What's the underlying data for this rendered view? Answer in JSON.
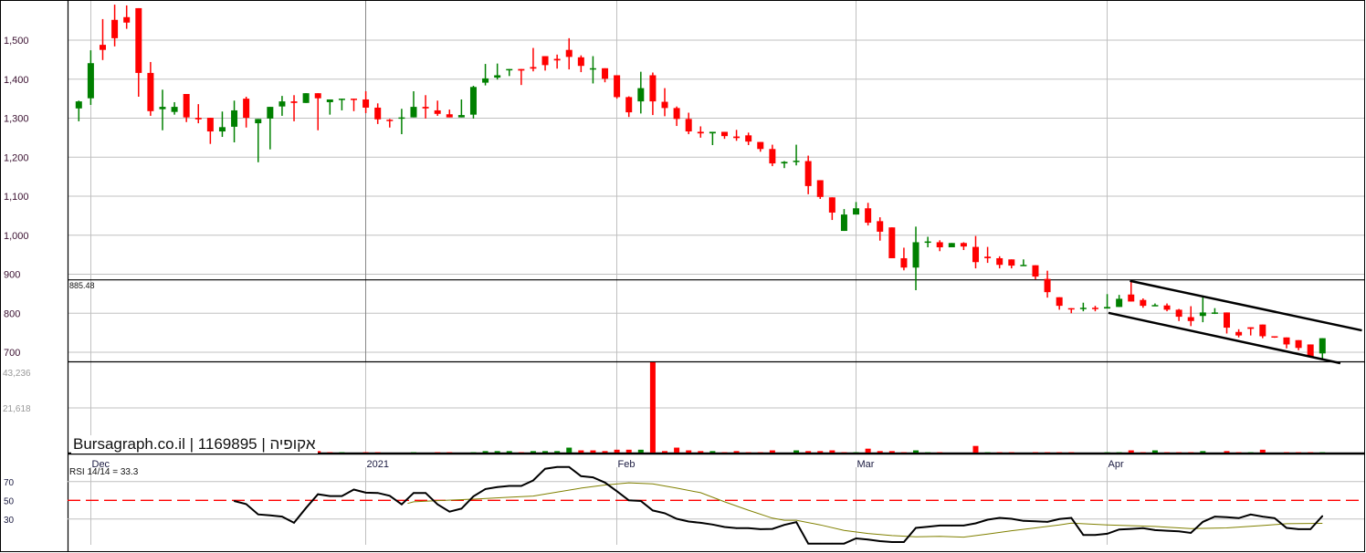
{
  "chart_data": {
    "type": "candlestick",
    "title": "Bursagraph.co.il | 1169895 | אקופיה",
    "colors": {
      "up": "#008000",
      "down": "#ff0000",
      "grid": "#c0c0c0",
      "axis_text": "#3a1030",
      "volume_text": "#999999",
      "rsi_line": "#000000",
      "rsi_signal": "#808000",
      "rsi_midline": "#ff0000"
    },
    "price_axis": {
      "ticks": [
        1500,
        1400,
        1300,
        1200,
        1100,
        1000,
        900,
        800,
        700
      ],
      "tick_labels": [
        "1,500",
        "1,400",
        "1,300",
        "1,200",
        "1,100",
        "1,000",
        "900",
        "800",
        "700"
      ],
      "ylim": [
        680,
        1600
      ]
    },
    "x_labels": [
      {
        "index": 1,
        "label": "Dec"
      },
      {
        "index": 24,
        "label": "2021"
      },
      {
        "index": 45,
        "label": "Feb"
      },
      {
        "index": 65,
        "label": "Mar"
      },
      {
        "index": 86,
        "label": "Apr"
      }
    ],
    "ohlc": [
      [
        1325,
        1345,
        1292,
        1343
      ],
      [
        1351,
        1474,
        1334,
        1441
      ],
      [
        1488,
        1554,
        1449,
        1475
      ],
      [
        1552,
        1591,
        1484,
        1505
      ],
      [
        1559,
        1589,
        1529,
        1545
      ],
      [
        1582,
        1582,
        1355,
        1416
      ],
      [
        1416,
        1444,
        1306,
        1318
      ],
      [
        1323,
        1373,
        1269,
        1329
      ],
      [
        1316,
        1341,
        1309,
        1329
      ],
      [
        1362,
        1362,
        1290,
        1302
      ],
      [
        1301,
        1336,
        1287,
        1297
      ],
      [
        1301,
        1301,
        1234,
        1266
      ],
      [
        1266,
        1317,
        1252,
        1277
      ],
      [
        1278,
        1345,
        1238,
        1320
      ],
      [
        1350,
        1355,
        1276,
        1301
      ],
      [
        1287,
        1298,
        1187,
        1298
      ],
      [
        1299,
        1329,
        1220,
        1329
      ],
      [
        1330,
        1357,
        1306,
        1343
      ],
      [
        1343,
        1359,
        1292,
        1339
      ],
      [
        1339,
        1364,
        1339,
        1364
      ],
      [
        1364,
        1364,
        1269,
        1351
      ],
      [
        1341,
        1348,
        1309,
        1348
      ],
      [
        1348,
        1350,
        1320,
        1350
      ],
      [
        1350,
        1350,
        1318,
        1348
      ],
      [
        1348,
        1369,
        1313,
        1327
      ],
      [
        1327,
        1338,
        1285,
        1297
      ],
      [
        1296,
        1298,
        1276,
        1294
      ],
      [
        1299,
        1324,
        1259,
        1302
      ],
      [
        1302,
        1369,
        1302,
        1329
      ],
      [
        1329,
        1359,
        1299,
        1325
      ],
      [
        1320,
        1345,
        1306,
        1311
      ],
      [
        1310,
        1322,
        1302,
        1302
      ],
      [
        1302,
        1348,
        1302,
        1308
      ],
      [
        1309,
        1383,
        1299,
        1380
      ],
      [
        1391,
        1439,
        1384,
        1402
      ],
      [
        1404,
        1440,
        1399,
        1410
      ],
      [
        1425,
        1426,
        1408,
        1426
      ],
      [
        1426,
        1426,
        1385,
        1422
      ],
      [
        1431,
        1480,
        1420,
        1427
      ],
      [
        1459,
        1459,
        1422,
        1436
      ],
      [
        1452,
        1463,
        1427,
        1448
      ],
      [
        1475,
        1505,
        1425,
        1457
      ],
      [
        1456,
        1461,
        1418,
        1434
      ],
      [
        1427,
        1459,
        1389,
        1428
      ],
      [
        1428,
        1428,
        1392,
        1401
      ],
      [
        1410,
        1410,
        1350,
        1354
      ],
      [
        1354,
        1356,
        1303,
        1315
      ],
      [
        1343,
        1419,
        1312,
        1377
      ],
      [
        1410,
        1417,
        1308,
        1343
      ],
      [
        1342,
        1377,
        1305,
        1326
      ],
      [
        1326,
        1330,
        1280,
        1298
      ],
      [
        1298,
        1314,
        1259,
        1266
      ],
      [
        1265,
        1279,
        1250,
        1261
      ],
      [
        1261,
        1265,
        1231,
        1265
      ],
      [
        1265,
        1265,
        1247,
        1254
      ],
      [
        1253,
        1270,
        1242,
        1249
      ],
      [
        1256,
        1263,
        1231,
        1240
      ],
      [
        1239,
        1239,
        1214,
        1221
      ],
      [
        1221,
        1232,
        1177,
        1184
      ],
      [
        1184,
        1190,
        1172,
        1188
      ],
      [
        1189,
        1232,
        1179,
        1191
      ],
      [
        1190,
        1204,
        1105,
        1126
      ],
      [
        1141,
        1141,
        1093,
        1098
      ],
      [
        1097,
        1097,
        1039,
        1058
      ],
      [
        1011,
        1067,
        1011,
        1053
      ],
      [
        1053,
        1085,
        1053,
        1069
      ],
      [
        1069,
        1083,
        1025,
        1032
      ],
      [
        1036,
        1046,
        986,
        1009
      ],
      [
        1020,
        1020,
        941,
        941
      ],
      [
        941,
        968,
        910,
        917
      ],
      [
        917,
        1022,
        859,
        982
      ],
      [
        982,
        996,
        969,
        984
      ],
      [
        982,
        987,
        959,
        969
      ],
      [
        969,
        980,
        969,
        980
      ],
      [
        980,
        982,
        962,
        971
      ],
      [
        970,
        998,
        915,
        931
      ],
      [
        945,
        970,
        929,
        941
      ],
      [
        941,
        946,
        915,
        924
      ],
      [
        938,
        938,
        915,
        922
      ],
      [
        922,
        938,
        922,
        924
      ],
      [
        923,
        923,
        887,
        894
      ],
      [
        888,
        909,
        840,
        854
      ],
      [
        841,
        841,
        809,
        819
      ],
      [
        813,
        813,
        800,
        812
      ],
      [
        812,
        827,
        805,
        814
      ],
      [
        814,
        819,
        805,
        812
      ],
      [
        812,
        849,
        812,
        816
      ],
      [
        816,
        847,
        816,
        837
      ],
      [
        848,
        884,
        830,
        830
      ],
      [
        834,
        838,
        814,
        819
      ],
      [
        819,
        825,
        819,
        821
      ],
      [
        820,
        825,
        805,
        809
      ],
      [
        809,
        811,
        780,
        791
      ],
      [
        790,
        818,
        767,
        780
      ],
      [
        793,
        845,
        777,
        802
      ],
      [
        800,
        813,
        798,
        802
      ],
      [
        802,
        802,
        748,
        763
      ],
      [
        752,
        759,
        738,
        743
      ],
      [
        764,
        764,
        743,
        760
      ],
      [
        771,
        771,
        736,
        741
      ],
      [
        741,
        741,
        737,
        738
      ],
      [
        738,
        738,
        710,
        720
      ],
      [
        731,
        731,
        705,
        711
      ],
      [
        720,
        720,
        689,
        689
      ],
      [
        697,
        736,
        682,
        736
      ]
    ],
    "horizontal_line": {
      "value": 885.48,
      "label": "885.48"
    },
    "trendlines": [
      {
        "name": "channel-upper",
        "from": [
          87.9,
          883
        ],
        "to": [
          107.3,
          756
        ]
      },
      {
        "name": "channel-lower",
        "from": [
          86.1,
          801
        ],
        "to": [
          105.5,
          672
        ]
      }
    ],
    "volume_axis": {
      "ticks": [
        43236,
        21618
      ],
      "tick_labels": [
        "43,236",
        "21,618"
      ]
    },
    "volume": [
      [
        18,
        650,
        "down"
      ],
      [
        19,
        650,
        "up"
      ],
      [
        20,
        1150,
        "down"
      ],
      [
        21,
        650,
        "down"
      ],
      [
        22,
        650,
        "up"
      ],
      [
        24,
        650,
        "down"
      ],
      [
        25,
        650,
        "down"
      ],
      [
        28,
        650,
        "up"
      ],
      [
        30,
        650,
        "down"
      ],
      [
        31,
        650,
        "down"
      ],
      [
        33,
        650,
        "up"
      ],
      [
        34,
        1150,
        "up"
      ],
      [
        35,
        1150,
        "up"
      ],
      [
        36,
        1150,
        "up"
      ],
      [
        37,
        650,
        "down"
      ],
      [
        38,
        1150,
        "up"
      ],
      [
        39,
        1150,
        "up"
      ],
      [
        40,
        1150,
        "up"
      ],
      [
        41,
        2800,
        "up"
      ],
      [
        42,
        1500,
        "down"
      ],
      [
        43,
        1500,
        "down"
      ],
      [
        44,
        1150,
        "down"
      ],
      [
        45,
        1800,
        "down"
      ],
      [
        46,
        1800,
        "down"
      ],
      [
        47,
        1800,
        "up"
      ],
      [
        48,
        44000,
        "down"
      ],
      [
        49,
        1150,
        "down"
      ],
      [
        50,
        2800,
        "down"
      ],
      [
        51,
        1500,
        "down"
      ],
      [
        52,
        1150,
        "down"
      ],
      [
        53,
        1150,
        "up"
      ],
      [
        54,
        650,
        "down"
      ],
      [
        55,
        1150,
        "down"
      ],
      [
        56,
        650,
        "down"
      ],
      [
        57,
        650,
        "down"
      ],
      [
        58,
        1500,
        "down"
      ],
      [
        60,
        1500,
        "up"
      ],
      [
        61,
        1150,
        "down"
      ],
      [
        62,
        1150,
        "down"
      ],
      [
        63,
        1500,
        "down"
      ],
      [
        64,
        650,
        "down"
      ],
      [
        65,
        650,
        "up"
      ],
      [
        66,
        2300,
        "down"
      ],
      [
        67,
        1150,
        "down"
      ],
      [
        68,
        1150,
        "down"
      ],
      [
        69,
        650,
        "down"
      ],
      [
        70,
        1500,
        "up"
      ],
      [
        71,
        650,
        "up"
      ],
      [
        72,
        650,
        "down"
      ],
      [
        75,
        3600,
        "down"
      ],
      [
        76,
        650,
        "up"
      ],
      [
        77,
        650,
        "down"
      ],
      [
        78,
        650,
        "down"
      ],
      [
        80,
        650,
        "down"
      ],
      [
        81,
        650,
        "down"
      ],
      [
        82,
        650,
        "down"
      ],
      [
        83,
        650,
        "down"
      ],
      [
        86,
        650,
        "up"
      ],
      [
        87,
        650,
        "up"
      ],
      [
        88,
        1500,
        "down"
      ],
      [
        89,
        650,
        "down"
      ],
      [
        90,
        1500,
        "up"
      ],
      [
        91,
        650,
        "down"
      ],
      [
        92,
        650,
        "down"
      ],
      [
        93,
        650,
        "down"
      ],
      [
        94,
        1150,
        "up"
      ],
      [
        96,
        1150,
        "down"
      ],
      [
        97,
        650,
        "down"
      ],
      [
        98,
        650,
        "up"
      ],
      [
        99,
        1800,
        "down"
      ],
      [
        101,
        650,
        "down"
      ],
      [
        102,
        650,
        "down"
      ],
      [
        103,
        650,
        "down"
      ],
      [
        104,
        650,
        "up"
      ]
    ],
    "rsi": {
      "label": "RSI 14/14 = 33.3",
      "ticks": [
        70,
        50,
        30
      ],
      "tick_labels": [
        "70",
        "50",
        "30"
      ],
      "midline": 50,
      "start_index": 13,
      "values": [
        49.3,
        46,
        35,
        34,
        32.6,
        26,
        41.8,
        56.5,
        54.6,
        54.6,
        61.5,
        58.2,
        57.9,
        54.9,
        45.7,
        57.9,
        57.9,
        45.7,
        37.9,
        41.1,
        54.3,
        62.1,
        64.1,
        65.4,
        65.4,
        71.3,
        83.8,
        85.7,
        85.7,
        75.9,
        74.6,
        69,
        59.8,
        50,
        49.3,
        39.2,
        36.2,
        30.3,
        27.4,
        26,
        24.1,
        21.5,
        20.2,
        20.2,
        19.2,
        19.5,
        23.8,
        26.7,
        3.8,
        3.8,
        3.8,
        3.8,
        9.3,
        8,
        6.4,
        5.4,
        5.4,
        20.5,
        21.8,
        23.1,
        23.1,
        23.1,
        25.4,
        29.3,
        31.3,
        30.3,
        28,
        27.7,
        27,
        30,
        31.3,
        13,
        13,
        14.3,
        18.9,
        19.5,
        20.2,
        18.2,
        17.5,
        16.9,
        15.2,
        27,
        32.6,
        32,
        31,
        34.9,
        32.6,
        31,
        20.5,
        19.2,
        19.2,
        33.3
      ],
      "signal": [
        [
          27.5,
          46.7
        ],
        [
          28,
          48.4
        ],
        [
          30,
          49.7
        ],
        [
          33,
          51.3
        ],
        [
          36,
          53.3
        ],
        [
          38,
          54.6
        ],
        [
          40,
          58.9
        ],
        [
          42,
          63.1
        ],
        [
          44,
          66.4
        ],
        [
          46,
          68.7
        ],
        [
          48,
          67.7
        ],
        [
          50,
          63.1
        ],
        [
          52,
          58.2
        ],
        [
          54,
          48.4
        ],
        [
          56,
          39.5
        ],
        [
          58,
          31
        ],
        [
          59,
          28.7
        ],
        [
          60,
          28.7
        ],
        [
          62,
          23.8
        ],
        [
          64,
          17.9
        ],
        [
          66,
          14.6
        ],
        [
          68,
          12.3
        ],
        [
          70,
          11
        ],
        [
          72,
          11.6
        ],
        [
          74,
          10.7
        ],
        [
          76,
          13.9
        ],
        [
          78,
          17.5
        ],
        [
          80,
          20.5
        ],
        [
          82,
          23.8
        ],
        [
          83,
          25.7
        ],
        [
          86,
          23.8
        ],
        [
          90,
          22.1
        ],
        [
          93,
          19.8
        ],
        [
          96,
          20.5
        ],
        [
          99,
          23.1
        ],
        [
          101,
          25
        ],
        [
          104,
          25.4
        ]
      ]
    }
  }
}
